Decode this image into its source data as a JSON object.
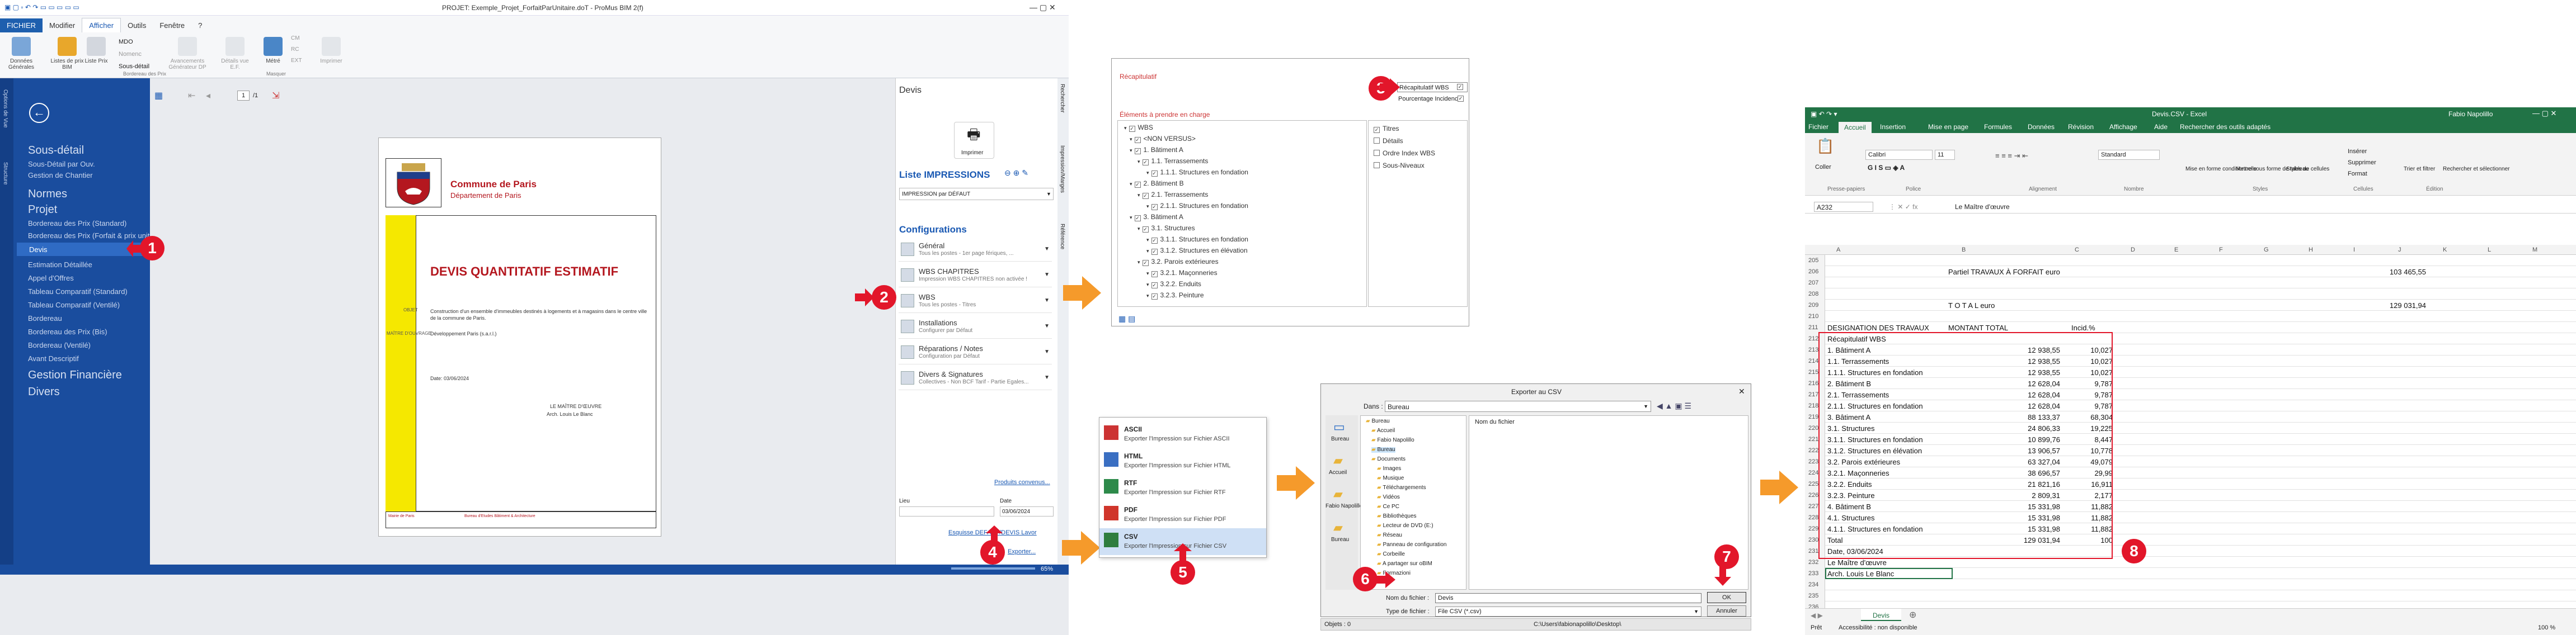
{
  "probim": {
    "title": "PROJET: Exemple_Projet_ForfaitParUnitaire.doT - ProMus   BIM 2(f)",
    "tabs": [
      "FICHIER",
      "Modifier",
      "Afficher",
      "Outils",
      "Fenêtre",
      "?"
    ],
    "ribbon_buttons": [
      "Données Générales",
      "Listes de prix BIM",
      "Liste Prix",
      "MDO",
      "Nomenc",
      "Sous-détail",
      "Avancements Générateur DP",
      "Détails vue E.F.",
      "Métré",
      "Imprimer"
    ],
    "ribbon_small": [
      "CM",
      "RC",
      "EXT"
    ],
    "ribbon_groups": [
      "Bordereau des Prix",
      "Masquer"
    ],
    "vstrip_labels": [
      "Options de Vue",
      "Structure"
    ],
    "sidebar_items": [
      "Sous-détail",
      "Sous-Détail par Ouv.",
      "Gestion de Chantier",
      "Normes",
      "Projet",
      "Bordereau des Prix (Standard)",
      "Bordereau des Prix (Forfait & prix unitaire)",
      "Devis",
      "Estimation Détaillée",
      "Appel d'Offres",
      "Tableau Comparatif (Standard)",
      "Tableau Comparatif (Ventilé)",
      "Bordereau",
      "Bordereau des Prix (Bis)",
      "Bordereau (Ventilé)",
      "Avant Descriptif",
      "Gestion Financière",
      "Divers"
    ],
    "page_counter": "1",
    "page_total": "/1",
    "doc": {
      "org_title": "Commune de Paris",
      "org_sub": "Département de Paris",
      "main_title": "DEVIS QUANTITATIF ESTIMATIF",
      "objet_label": "OBJET",
      "objet_text": "Construction d'un ensemble d'immeubles destinés à logements et à magasins dans le centre ville de la commune de Paris.",
      "maitre_label": "MAÎTRE D'OUVRAGE",
      "maitre_text": "Développement Paris (s.a.r.l.)",
      "date": "Date: 03/06/2024",
      "signatory_title": "LE MAÎTRE D'ŒUVRE",
      "signatory_name": "Arch. Louis Le Blanc",
      "footer_left": "Mairie de Paris",
      "footer_right": "Bureau d'Etudes Bâtiment & Architecture"
    },
    "zoom": "65%",
    "right": {
      "header": "Devis",
      "print_label": "Imprimer",
      "liste_header": "Liste IMPRESSIONS",
      "liste_select": "IMPRESSION par DÉFAUT",
      "config_header": "Configurations",
      "configs": [
        {
          "name": "Général",
          "desc": "Tous les postes - 1er page fériques, ..."
        },
        {
          "name": "WBS CHAPITRES",
          "desc": "Impression WBS CHAPITRES non activée !"
        },
        {
          "name": "WBS",
          "desc": "Tous les postes - Titres"
        },
        {
          "name": "Installations",
          "desc": "Configurer par Défaut"
        },
        {
          "name": "Réparations / Notes",
          "desc": "Configuration par Défaut"
        },
        {
          "name": "Divers & Signatures",
          "desc": "Collectives - Non BCF Tarif - Partie Egales..."
        }
      ],
      "prod_link": "Produits convenus...",
      "lieu_label": "Lieu",
      "date_label": "Date",
      "date_value": "03/06/2024",
      "sketch_label": "Esquisse DEFAUT/DEVIS Lavor",
      "export_label": "Exporter..."
    },
    "vtabs": [
      "Rechercher",
      "Impression/Marges",
      "Référence"
    ]
  },
  "dlg1": {
    "opt1": "Récapitulatif WBS",
    "opt2": "Pourcentage Incidence",
    "section": "Éléments à prendre en charge",
    "tree": [
      "WBS",
      "<NON VERSUS>",
      "1. Bâtiment A",
      "1.1. Terrassements",
      "1.1.1. Structures en fondation",
      "2. Bâtiment B",
      "2.1. Terrassements",
      "2.1.1. Structures en fondation",
      "3. Bâtiment A",
      "3.1. Structures",
      "3.1.1. Structures en fondation",
      "3.1.2. Structures en élévation",
      "3.2. Parois extérieures",
      "3.2.1. Maçonneries",
      "3.2.2. Enduits",
      "3.2.3. Peinture"
    ],
    "right_opts": [
      "Titres",
      "Détails",
      "Ordre Index WBS",
      "Sous-Niveaux"
    ]
  },
  "menu": {
    "items": [
      {
        "name": "ASCII",
        "desc": "Exporter l'Impression sur Fichier ASCII"
      },
      {
        "name": "HTML",
        "desc": "Exporter l'Impression sur Fichier HTML"
      },
      {
        "name": "RTF",
        "desc": "Exporter l'Impression sur Fichier RTF"
      },
      {
        "name": "PDF",
        "desc": "Exporter l'Impression sur Fichier PDF"
      },
      {
        "name": "CSV",
        "desc": "Exporter l'Impression sur Fichier CSV"
      }
    ]
  },
  "dlg2": {
    "title": "Exporter au CSV",
    "dans_label": "Dans :",
    "dans_value": "Bureau",
    "places": [
      "Bureau",
      "Accueil",
      "Fabio Napolillo",
      "Bureau"
    ],
    "folders": [
      "Bureau",
      "Accueil",
      "Fabio Napolillo",
      "Bureau",
      "Documents",
      "Images",
      "Musique",
      "Téléchargements",
      "Vidéos",
      "Ce PC",
      "Bibliothèques",
      "Lecteur de DVD (E:)",
      "Réseau",
      "Panneau de configuration",
      "Corbeille",
      "A partager sur oBIM",
      "Formazioni"
    ],
    "col_header": "Nom du fichier",
    "filename_label": "Nom du fichier :",
    "filename_value": "Devis",
    "type_label": "Type de fichier :",
    "type_value": "File CSV (*.csv)",
    "ok": "OK",
    "cancel": "Annuler",
    "objects": "Objets : 0",
    "path": "C:\\Users\\fabionapolillo\\Desktop\\"
  },
  "excel": {
    "title": "Devis.CSV - Excel",
    "user": "Fabio Napolillo",
    "tabs": [
      "Fichier",
      "Accueil",
      "Insertion",
      "Mise en page",
      "Formules",
      "Données",
      "Révision",
      "Affichage",
      "Aide",
      "Rechercher des outils adaptés"
    ],
    "font": "Calibri",
    "font_size": "11",
    "number_format": "Standard",
    "groups": [
      "Presse-papiers",
      "Police",
      "Alignement",
      "Nombre",
      "Styles",
      "Cellules",
      "Édition"
    ],
    "cell_ref": "A232",
    "formula": "Le Maître d'œuvre",
    "cols": [
      "A",
      "B",
      "C",
      "D",
      "E",
      "F",
      "G",
      "H",
      "I",
      "J",
      "K",
      "L",
      "M"
    ],
    "rows": [
      {
        "n": "205",
        "a": "",
        "b": "",
        "c": "",
        "i": ""
      },
      {
        "n": "206",
        "a": "",
        "b": "Partiel TRAVAUX À FORFAIT euro",
        "c": "",
        "i": "103 465,55"
      },
      {
        "n": "207",
        "a": "",
        "b": "",
        "c": "",
        "i": ""
      },
      {
        "n": "208",
        "a": "",
        "b": "",
        "c": "",
        "i": ""
      },
      {
        "n": "209",
        "a": "",
        "b": "T O T A L   euro",
        "c": "",
        "i": "129 031,94"
      },
      {
        "n": "210",
        "a": "",
        "b": "",
        "c": "",
        "i": ""
      },
      {
        "n": "211",
        "a": "DESIGNATION DES TRAVAUX",
        "b": "MONTANT TOTAL",
        "c": "Incid.%",
        "i": ""
      },
      {
        "n": "212",
        "a": "Récapitulatif  WBS",
        "b": "",
        "c": "",
        "i": ""
      },
      {
        "n": "213",
        "a": "1. Bâtiment A",
        "b": "12 938,55",
        "c": "10,027",
        "i": ""
      },
      {
        "n": "214",
        "a": "1.1. Terrassements",
        "b": "12 938,55",
        "c": "10,027",
        "i": ""
      },
      {
        "n": "215",
        "a": "1.1.1. Structures en fondation",
        "b": "12 938,55",
        "c": "10,027",
        "i": ""
      },
      {
        "n": "216",
        "a": "2. Bâtiment B",
        "b": "12 628,04",
        "c": "9,787",
        "i": ""
      },
      {
        "n": "217",
        "a": "2.1. Terrassements",
        "b": "12 628,04",
        "c": "9,787",
        "i": ""
      },
      {
        "n": "218",
        "a": "2.1.1. Structures en fondation",
        "b": "12 628,04",
        "c": "9,787",
        "i": ""
      },
      {
        "n": "219",
        "a": "3. Bâtiment A",
        "b": "88 133,37",
        "c": "68,304",
        "i": ""
      },
      {
        "n": "220",
        "a": "3.1. Structures",
        "b": "24 806,33",
        "c": "19,225",
        "i": ""
      },
      {
        "n": "221",
        "a": "3.1.1. Structures en fondation",
        "b": "10 899,76",
        "c": "8,447",
        "i": ""
      },
      {
        "n": "222",
        "a": "3.1.2. Structures en élévation",
        "b": "13 906,57",
        "c": "10,778",
        "i": ""
      },
      {
        "n": "223",
        "a": "3.2. Parois extérieures",
        "b": "63 327,04",
        "c": "49,079",
        "i": ""
      },
      {
        "n": "224",
        "a": "3.2.1. Maçonneries",
        "b": "38 696,57",
        "c": "29,99",
        "i": ""
      },
      {
        "n": "225",
        "a": "3.2.2. Enduits",
        "b": "21 821,16",
        "c": "16,911",
        "i": ""
      },
      {
        "n": "226",
        "a": "3.2.3. Peinture",
        "b": "2 809,31",
        "c": "2,177",
        "i": ""
      },
      {
        "n": "227",
        "a": "4. Bâtiment B",
        "b": "15 331,98",
        "c": "11,882",
        "i": ""
      },
      {
        "n": "228",
        "a": "4.1. Structures",
        "b": "15 331,98",
        "c": "11,882",
        "i": ""
      },
      {
        "n": "229",
        "a": "4.1.1. Structures en fondation",
        "b": "15 331,98",
        "c": "11,882",
        "i": ""
      },
      {
        "n": "230",
        "a": "Total",
        "b": "129 031,94",
        "c": "100",
        "i": ""
      },
      {
        "n": "231",
        "a": "Date, 03/06/2024",
        "b": "",
        "c": "",
        "i": ""
      },
      {
        "n": "232",
        "a": "Le Maître d'œuvre",
        "b": "",
        "c": "",
        "i": ""
      },
      {
        "n": "233",
        "a": "Arch. Louis Le Blanc",
        "b": "",
        "c": "",
        "i": ""
      },
      {
        "n": "234",
        "a": "",
        "b": "",
        "c": "",
        "i": ""
      },
      {
        "n": "235",
        "a": "",
        "b": "",
        "c": "",
        "i": ""
      },
      {
        "n": "236",
        "a": "",
        "b": "",
        "c": "",
        "i": ""
      }
    ],
    "sheet_tab": "Devis",
    "status_left": "Prêt",
    "status_access": "Accessibilité : non disponible",
    "zoom": "100 %",
    "ribbon_labels": [
      "Coller",
      "Mise en forme conditionnelle",
      "Mettre sous forme de tableau",
      "Styles de cellules",
      "Insérer",
      "Supprimer",
      "Format",
      "Trier et filtrer",
      "Rechercher et sélectionner"
    ]
  },
  "markers": [
    "1",
    "2",
    "3",
    "4",
    "5",
    "6",
    "7",
    "8"
  ],
  "colors": {
    "accent": "#1a4d9e",
    "marker": "#e2162a",
    "arrow": "#f59a2b",
    "excel": "#217346",
    "doc_yellow": "#f5e800"
  }
}
